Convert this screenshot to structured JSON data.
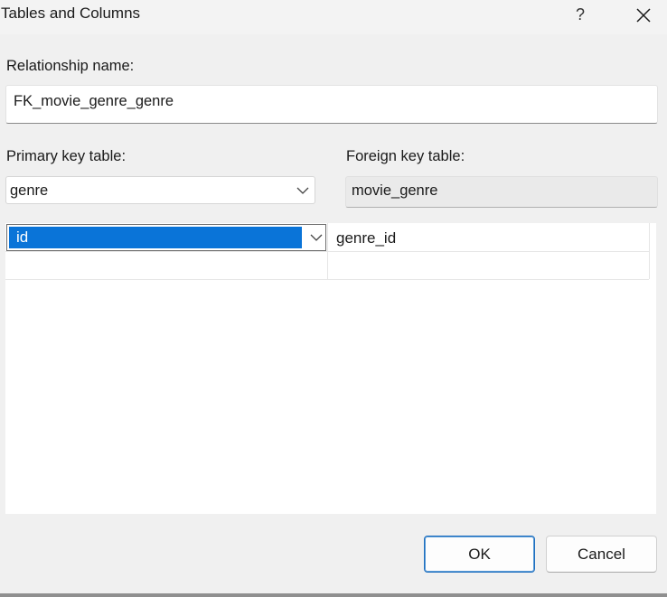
{
  "window": {
    "title": "Tables and Columns",
    "help_glyph": "?"
  },
  "relationship": {
    "label": "Relationship name:",
    "value": "FK_movie_genre_genre"
  },
  "primary_key": {
    "label": "Primary key table:",
    "selected": "genre"
  },
  "foreign_key": {
    "label": "Foreign key table:",
    "value": "movie_genre"
  },
  "column_grid": {
    "rows": [
      {
        "primary_column": "id",
        "foreign_column": "genre_id"
      }
    ]
  },
  "buttons": {
    "ok": "OK",
    "cancel": "Cancel"
  },
  "colors": {
    "selection": "#0a74d8",
    "default_button_border": "#1f6fbf",
    "dialog_bg": "#f0f0f0"
  },
  "icons": {
    "close": "close-icon",
    "help": "help-icon",
    "dropdown": "chevron-down-icon"
  }
}
